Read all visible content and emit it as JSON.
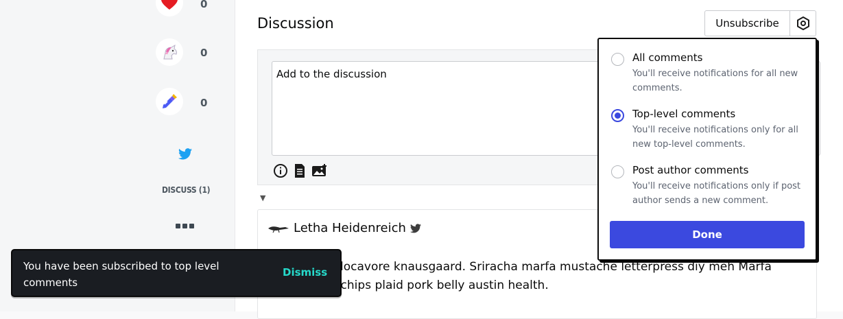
{
  "sidebar": {
    "reactions": [
      {
        "name": "heart-icon",
        "count": "0"
      },
      {
        "name": "unicorn-icon",
        "count": "0"
      },
      {
        "name": "bookmark-icon",
        "count": "0"
      }
    ],
    "discuss_label": "DISCUSS (1)"
  },
  "main": {
    "title": "Discussion",
    "unsubscribe_label": "Unsubscribe",
    "composer_placeholder": "Add to the discussion"
  },
  "comment": {
    "author": "Letha Heidenreich",
    "body": "Small batch locavore knausgaard. Sriracha marfa mustache letterpress diy meh Marfa mlkshk kale chips plaid pork belly austin health."
  },
  "dropdown": {
    "options": [
      {
        "title": "All comments",
        "desc": "You'll receive notifications for all new comments.",
        "checked": false
      },
      {
        "title": "Top-level comments",
        "desc": "You'll receive notifications only for all new top-level comments.",
        "checked": true
      },
      {
        "title": "Post author comments",
        "desc": "You'll receive notifications only if post author sends a new comment.",
        "checked": false
      }
    ],
    "done_label": "Done"
  },
  "snackbar": {
    "message": "You have been subscribed to top level comments",
    "dismiss_label": "Dismiss"
  },
  "colors": {
    "accent": "#3b49df",
    "twitter": "#1da1f2",
    "dismiss": "#26d9ca"
  }
}
